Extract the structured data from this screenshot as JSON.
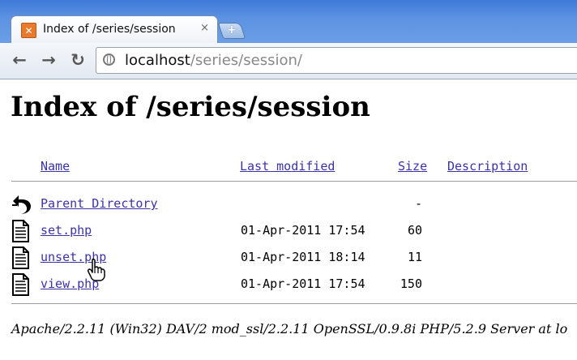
{
  "browser": {
    "tab": {
      "title": "Index of /series/session",
      "favicon_glyph": "✕",
      "close_glyph": "×"
    },
    "new_tab_glyph": "+",
    "back_glyph": "←",
    "forward_glyph": "→",
    "reload_glyph": "↻",
    "url_host": "localhost",
    "url_path": "/series/session/",
    "chrome_color": "#5c92e1"
  },
  "page": {
    "title": "Index of /series/session",
    "columns": {
      "name": "Name",
      "last_modified": "Last modified",
      "size": "Size",
      "description": "Description"
    },
    "entries": [
      {
        "icon": "back-arrow-icon",
        "name": "Parent Directory",
        "modified": "",
        "size": "-"
      },
      {
        "icon": "file-icon",
        "name": "set.php",
        "modified": "01-Apr-2011 17:54",
        "size": "60"
      },
      {
        "icon": "file-icon",
        "name": "unset.php",
        "modified": "01-Apr-2011 18:14",
        "size": "11"
      },
      {
        "icon": "file-icon",
        "name": "view.php",
        "modified": "01-Apr-2011 17:54",
        "size": "150"
      }
    ],
    "footer": "Apache/2.2.11 (Win32) DAV/2 mod_ssl/2.2.11 OpenSSL/0.9.8i PHP/5.2.9 Server at lo",
    "link_color": "#3a32a8"
  }
}
